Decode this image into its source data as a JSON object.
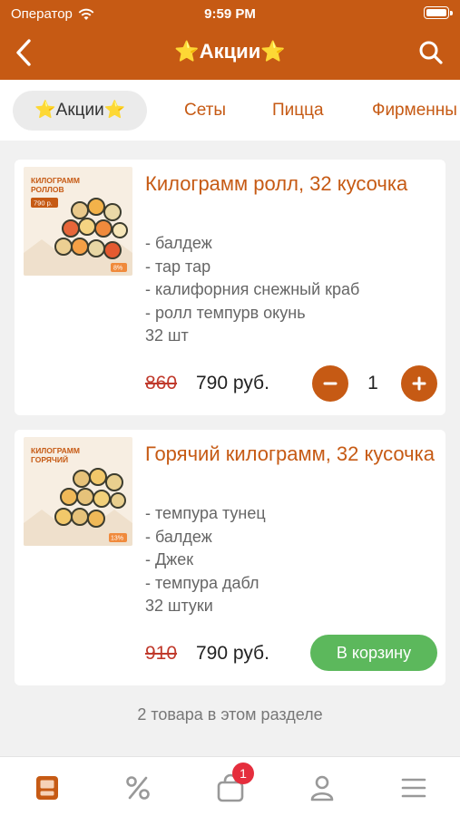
{
  "status_bar": {
    "carrier": "Оператор",
    "time": "9:59 PM"
  },
  "header": {
    "title": "⭐Акции⭐"
  },
  "tabs": [
    {
      "label": "⭐Акции⭐",
      "active": true
    },
    {
      "label": "Сеты"
    },
    {
      "label": "Пицца"
    },
    {
      "label": "Фирменны"
    }
  ],
  "products": [
    {
      "name": "Килограмм ролл, 32 кусочка",
      "image_title": "КИЛОГРАММ РОЛЛОВ",
      "image_price": "790 р.",
      "image_discount": "8%",
      "description": [
        "- балдеж",
        "- тар тар",
        "- калифорния снежный краб",
        "- ролл темпурв окунь",
        "32 шт"
      ],
      "old_price": "860",
      "price": "790 руб.",
      "quantity": "1"
    },
    {
      "name": "Горячий килограмм, 32 кусочка",
      "image_title": "КИЛОГРАММ ГОРЯЧИЙ",
      "image_discount": "13%",
      "description": [
        "- темпура тунец",
        "- балдеж",
        "- Джек",
        "- темпура дабл",
        "32 штуки"
      ],
      "old_price": "910",
      "price": "790 руб.",
      "cart_label": "В корзину"
    }
  ],
  "section_count": "2 товара в этом разделе",
  "bottom_nav": {
    "cart_badge": "1"
  },
  "colors": {
    "accent": "#c65a14",
    "cart_button": "#5cb85c",
    "badge": "#e52e3d",
    "old_price": "#c0392b"
  },
  "icons": [
    "back-icon",
    "search-icon",
    "wifi-icon",
    "battery-icon",
    "minus-icon",
    "plus-icon",
    "menu-icon",
    "percent-icon",
    "cart-icon",
    "profile-icon",
    "hamburger-icon"
  ]
}
